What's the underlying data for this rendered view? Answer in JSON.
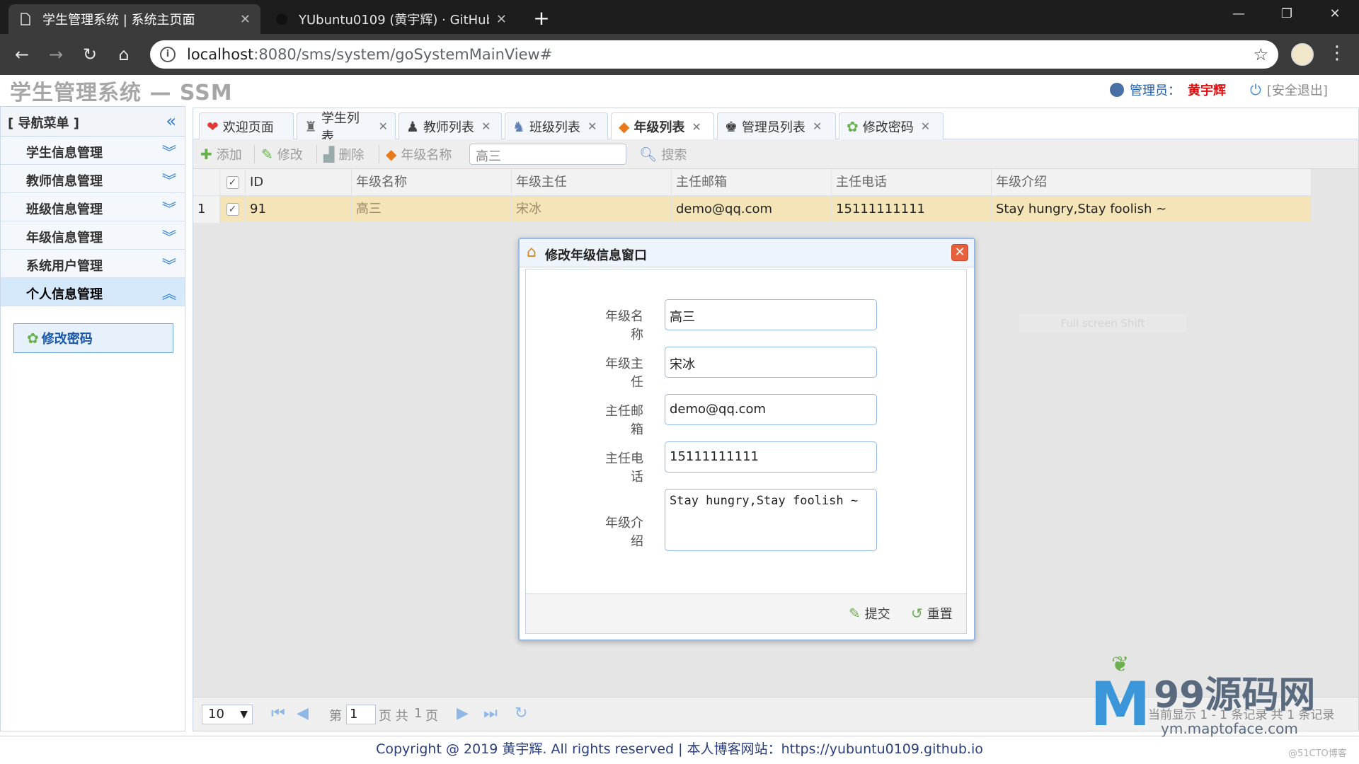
{
  "browser": {
    "tabs": [
      {
        "title": "学生管理系统 | 系统主页面",
        "active": true
      },
      {
        "title": "YUbuntu0109 (黄宇辉) · GitHub",
        "active": false
      }
    ],
    "url_host": "localhost",
    "url_path": ":8080/sms/system/goSystemMainView#"
  },
  "app": {
    "title": "学生管理系统 — SSM",
    "admin_label": "管理员：",
    "admin_name": "黄宇辉",
    "logout": "[安全退出]"
  },
  "sidebar": {
    "header": "[ 导航菜单 ]",
    "items": [
      {
        "label": "学生信息管理"
      },
      {
        "label": "教师信息管理"
      },
      {
        "label": "班级信息管理"
      },
      {
        "label": "年级信息管理"
      },
      {
        "label": "系统用户管理"
      },
      {
        "label": "个人信息管理",
        "expanded": true
      }
    ],
    "submenu": "修改密码"
  },
  "tabs": [
    "欢迎页面",
    "学生列表",
    "教师列表",
    "班级列表",
    "年级列表",
    "管理员列表",
    "修改密码"
  ],
  "active_tab": "年级列表",
  "toolbar": {
    "add": "添加",
    "edit": "修改",
    "delete": "删除",
    "field_label": "年级名称",
    "search_value": "高三",
    "search": "搜索"
  },
  "grid": {
    "columns": [
      "ID",
      "年级名称",
      "年级主任",
      "主任邮箱",
      "主任电话",
      "年级介绍"
    ],
    "rows": [
      {
        "num": "1",
        "id": "91",
        "name": "高三",
        "director": "宋冰",
        "email": "demo@qq.com",
        "phone": "15111111111",
        "intro": "Stay hungry,Stay foolish ~"
      }
    ]
  },
  "pager": {
    "page_size": "10",
    "page_prefix": "第",
    "page": "1",
    "page_suffix": "页 共",
    "total_pages": "1",
    "page_unit": "页",
    "info": "当前显示 1 - 1 条记录 共 1 条记录"
  },
  "dialog": {
    "title": "修改年级信息窗口",
    "fields": [
      {
        "label": "年级名称",
        "value": "高三"
      },
      {
        "label": "年级主任",
        "value": "宋冰"
      },
      {
        "label": "主任邮箱",
        "value": "demo@qq.com"
      },
      {
        "label": "主任电话",
        "value": "15111111111"
      },
      {
        "label": "年级介绍",
        "value": "Stay hungry,Stay foolish ~"
      }
    ],
    "submit": "提交",
    "reset": "重置"
  },
  "footer": "Copyright @ 2019 黄宇辉. All rights reserved | 本人博客网站：https://yubuntu0109.github.io",
  "watermark": {
    "brand": "99源码网",
    "url": "ym.maptoface.com",
    "credit": "@51CTO博客",
    "ghost": "Full screen Shift"
  },
  "colors": {
    "accent": "#95b8e7",
    "selected_row": "#f5e4b8",
    "admin_name": "#e01010"
  }
}
